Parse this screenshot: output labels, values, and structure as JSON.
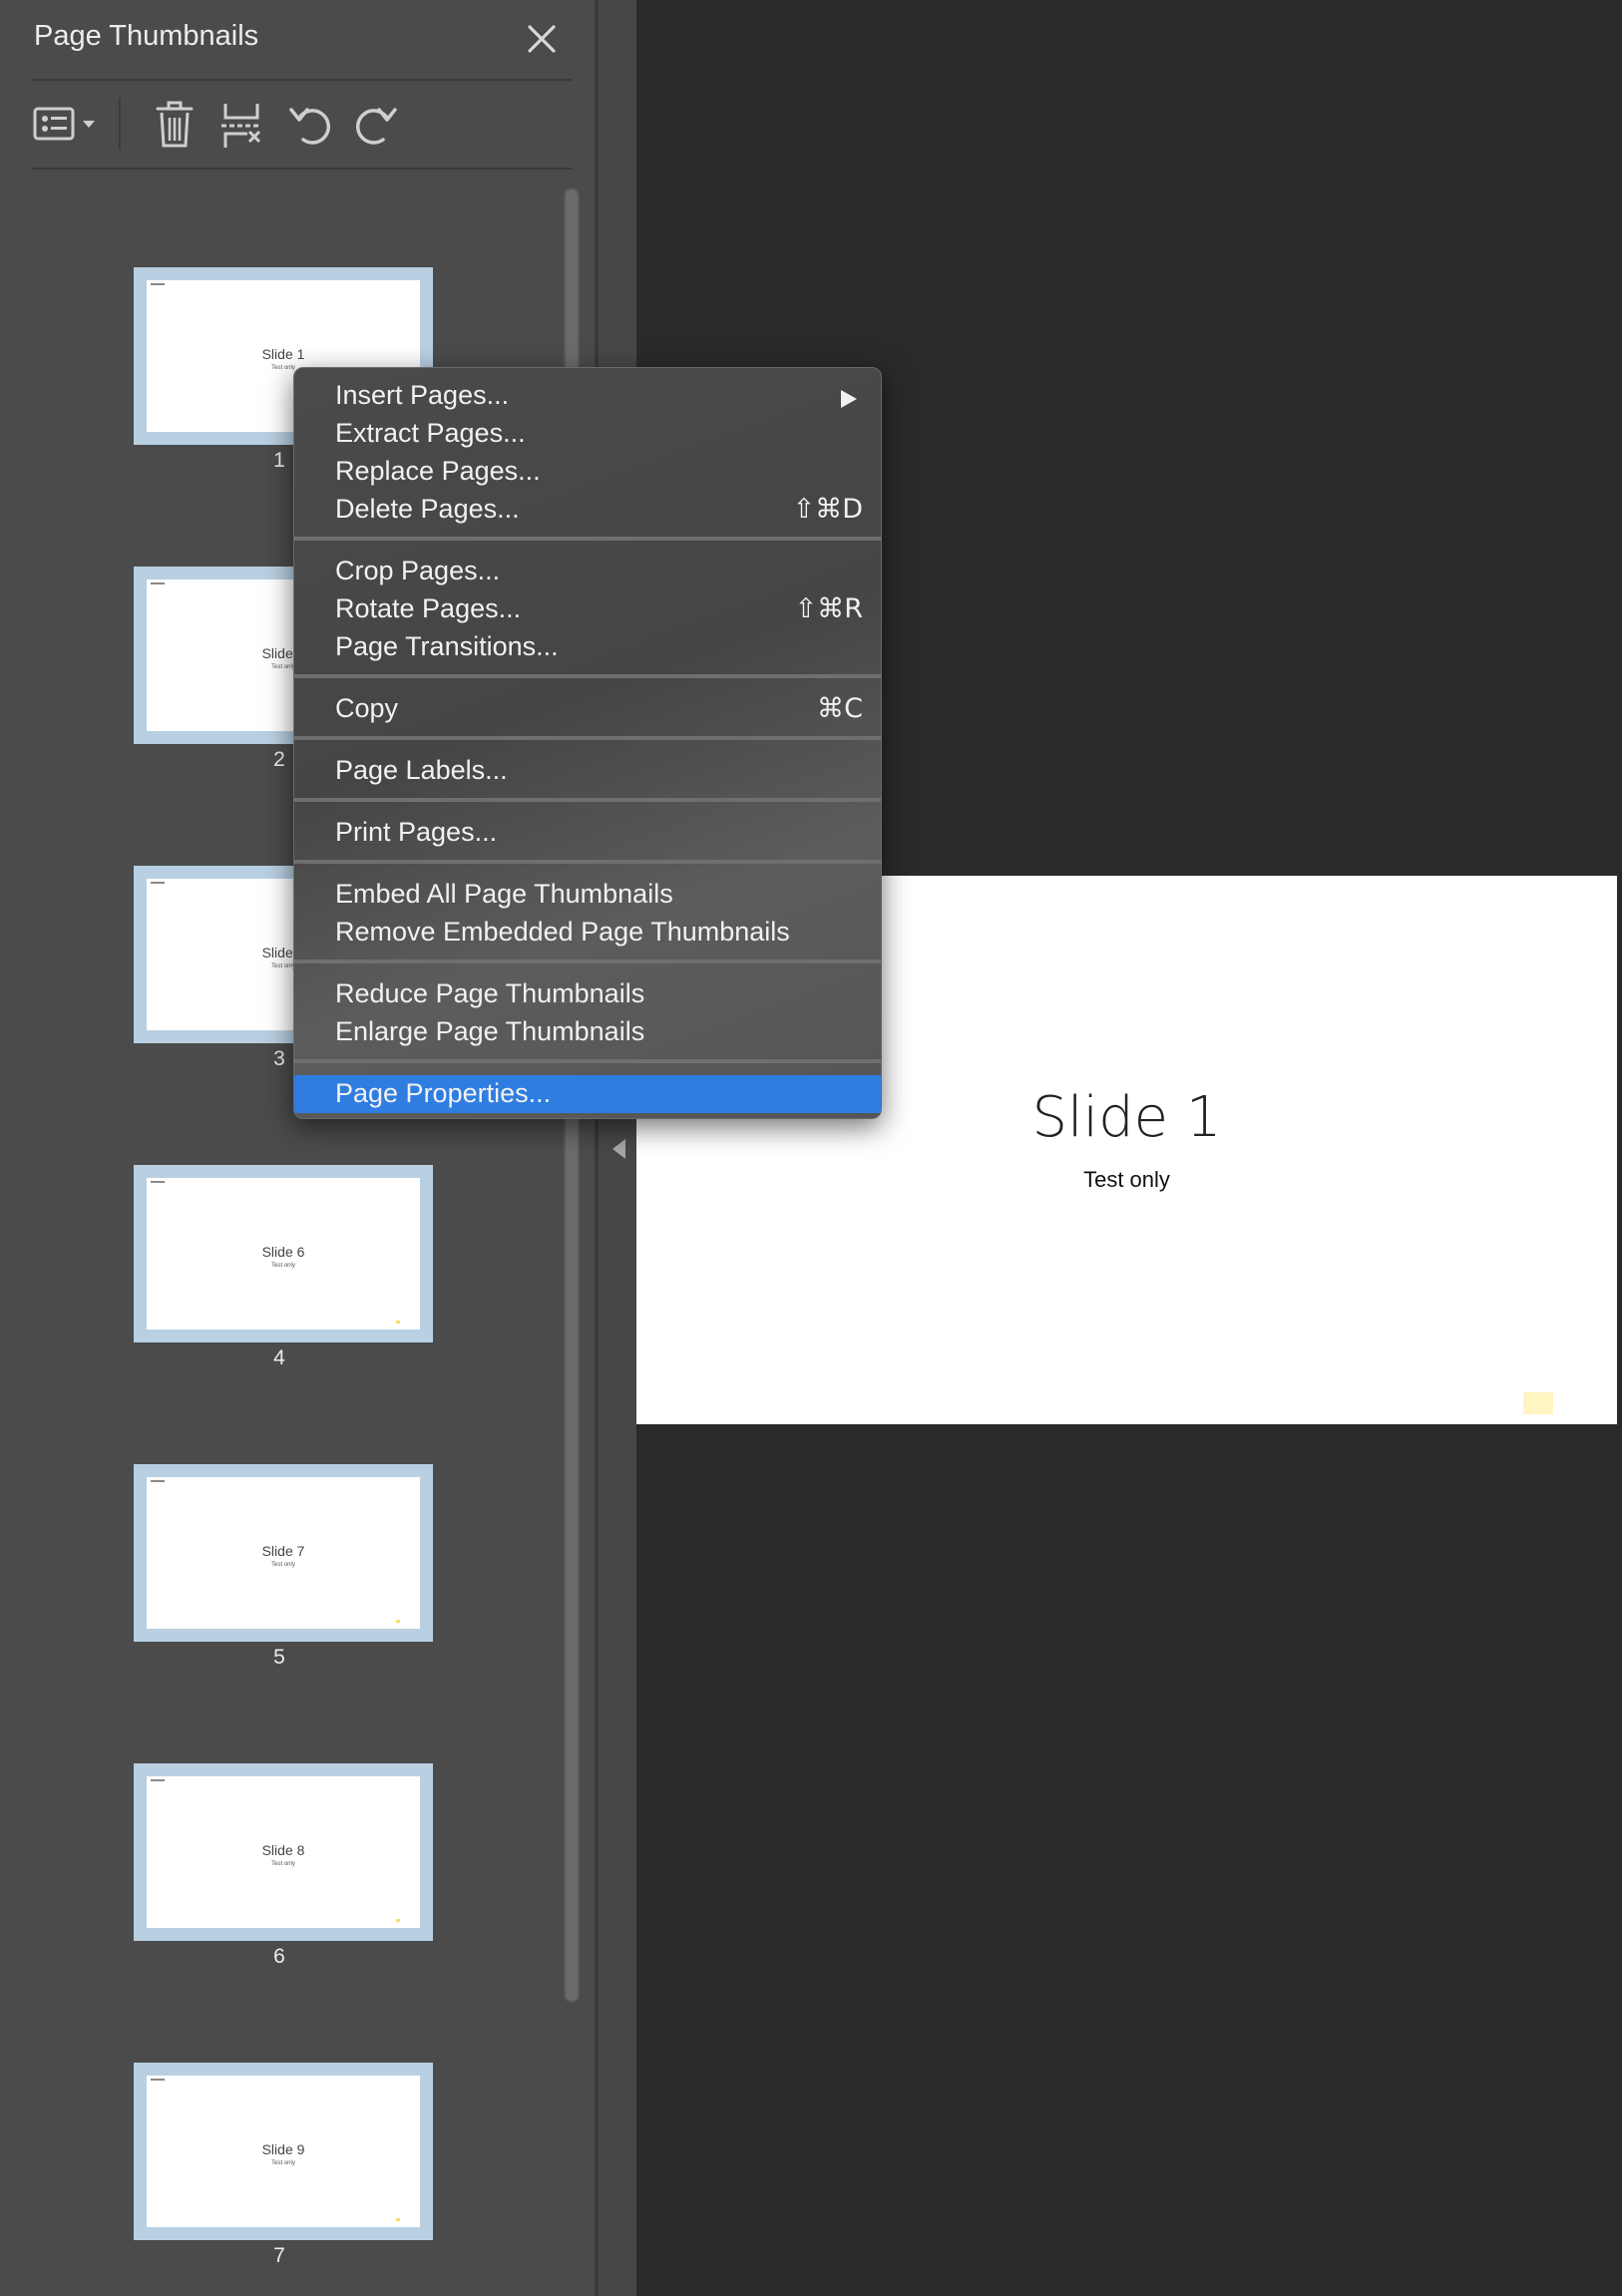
{
  "panel": {
    "title": "Page Thumbnails",
    "close_icon": "close-icon",
    "toolbar": [
      {
        "icon": "thumbnail-options-icon"
      },
      {
        "icon": "trash-icon"
      },
      {
        "icon": "insert-page-icon"
      },
      {
        "icon": "rotate-counterclockwise-icon"
      },
      {
        "icon": "rotate-clockwise-icon"
      }
    ]
  },
  "thumbnails": [
    {
      "slide_title": "Slide 1",
      "subtitle": "Test only",
      "page": "1"
    },
    {
      "slide_title": "Slide 2",
      "subtitle": "Test only",
      "page": "2"
    },
    {
      "slide_title": "Slide 3",
      "subtitle": "Test only",
      "page": "3"
    },
    {
      "slide_title": "Slide 6",
      "subtitle": "Test only",
      "page": "4"
    },
    {
      "slide_title": "Slide 7",
      "subtitle": "Test only",
      "page": "5"
    },
    {
      "slide_title": "Slide 8",
      "subtitle": "Test only",
      "page": "6"
    },
    {
      "slide_title": "Slide 9",
      "subtitle": "Test only",
      "page": "7"
    }
  ],
  "main_page": {
    "title": "Slide 1",
    "subtitle": "Test only"
  },
  "context_menu": {
    "items": [
      {
        "label": "Insert Pages...",
        "shortcut": "",
        "submenu": true
      },
      {
        "label": "Extract Pages...",
        "shortcut": ""
      },
      {
        "label": "Replace Pages...",
        "shortcut": ""
      },
      {
        "label": "Delete Pages...",
        "shortcut": "⇧⌘D"
      },
      {
        "label": "Crop Pages...",
        "shortcut": ""
      },
      {
        "label": "Rotate Pages...",
        "shortcut": "⇧⌘R"
      },
      {
        "label": "Page Transitions...",
        "shortcut": ""
      },
      {
        "label": "Copy",
        "shortcut": "⌘C"
      },
      {
        "label": "Page Labels...",
        "shortcut": ""
      },
      {
        "label": "Print Pages...",
        "shortcut": ""
      },
      {
        "label": "Embed All Page Thumbnails",
        "shortcut": ""
      },
      {
        "label": "Remove Embedded Page Thumbnails",
        "shortcut": ""
      },
      {
        "label": "Reduce Page Thumbnails",
        "shortcut": ""
      },
      {
        "label": "Enlarge Page Thumbnails",
        "shortcut": ""
      },
      {
        "label": "Page Properties...",
        "shortcut": "",
        "highlighted": true
      }
    ]
  },
  "colors": {
    "panel_bg": "#4b4b4b",
    "canvas_bg": "#2a2a2a",
    "thumb_frame": "#b8d0e2",
    "menu_highlight": "#2f7de1"
  }
}
